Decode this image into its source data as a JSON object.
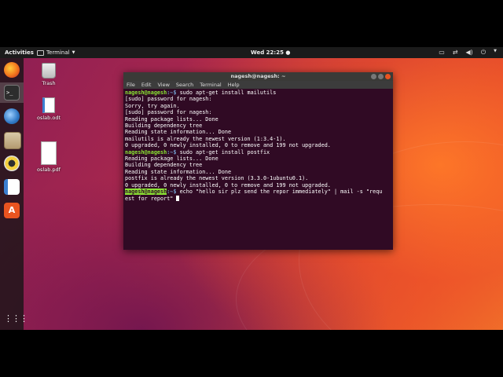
{
  "topbar": {
    "activities": "Activities",
    "app_name": "Terminal",
    "clock": "Wed 22:25"
  },
  "desktop": {
    "icons": [
      {
        "label": "Trash"
      },
      {
        "label": "oslab.odt"
      },
      {
        "label": "oslab.pdf"
      }
    ]
  },
  "terminal": {
    "title": "nagesh@nagesh: ~",
    "menu": [
      "File",
      "Edit",
      "View",
      "Search",
      "Terminal",
      "Help"
    ],
    "prompt_user": "nagesh@nagesh",
    "prompt_path": ":~$",
    "lines": [
      {
        "type": "cmd",
        "text": " sudo apt-get install mailutils"
      },
      {
        "type": "out",
        "text": "[sudo] password for nagesh:"
      },
      {
        "type": "out",
        "text": "Sorry, try again."
      },
      {
        "type": "out",
        "text": "[sudo] password for nagesh:"
      },
      {
        "type": "out",
        "text": "Reading package lists... Done"
      },
      {
        "type": "out",
        "text": "Building dependency tree"
      },
      {
        "type": "out",
        "text": "Reading state information... Done"
      },
      {
        "type": "out",
        "text": "mailutils is already the newest version (1:3.4-1)."
      },
      {
        "type": "out",
        "text": "0 upgraded, 0 newly installed, 0 to remove and 199 not upgraded."
      },
      {
        "type": "cmd",
        "text": " sudo apt-get install postfix"
      },
      {
        "type": "out",
        "text": "Reading package lists... Done"
      },
      {
        "type": "out",
        "text": "Building dependency tree"
      },
      {
        "type": "out",
        "text": "Reading state information... Done"
      },
      {
        "type": "out",
        "text": "postfix is already the newest version (3.3.0-1ubuntu0.1)."
      },
      {
        "type": "out",
        "text": "0 upgraded, 0 newly installed, 0 to remove and 199 not upgraded."
      }
    ],
    "current_prompt_user": "nagesh@nagesh",
    "current_prompt_path": ":~$",
    "current_command_line1": " echo \"hello sir plz send the repor immediately\" | mail -s \"requ",
    "current_command_line2": "est for report\" "
  },
  "colors": {
    "terminal_bg": "#300a24",
    "prompt_user": "#8ae234",
    "prompt_path": "#729fcf",
    "topbar": "#1b1b1b"
  }
}
